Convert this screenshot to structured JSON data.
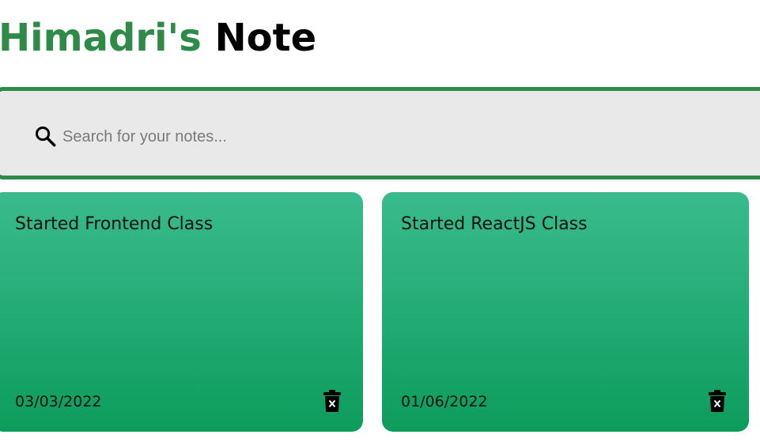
{
  "header": {
    "brand_first": "Himadri's",
    "brand_second": "Note"
  },
  "search": {
    "placeholder": "Search for your notes...",
    "value": "",
    "icon": "search-icon"
  },
  "notes": [
    {
      "title": "Started Frontend Class",
      "date": "03/03/2022",
      "delete_icon": "trash-icon"
    },
    {
      "title": "Started ReactJS Class",
      "date": "01/06/2022",
      "delete_icon": "trash-icon"
    }
  ],
  "colors": {
    "brand_green": "#2e8b47",
    "search_bg": "#e9e9ea",
    "note_gradient_top": "#3abb8e",
    "note_gradient_bottom": "#0d9c5c"
  }
}
